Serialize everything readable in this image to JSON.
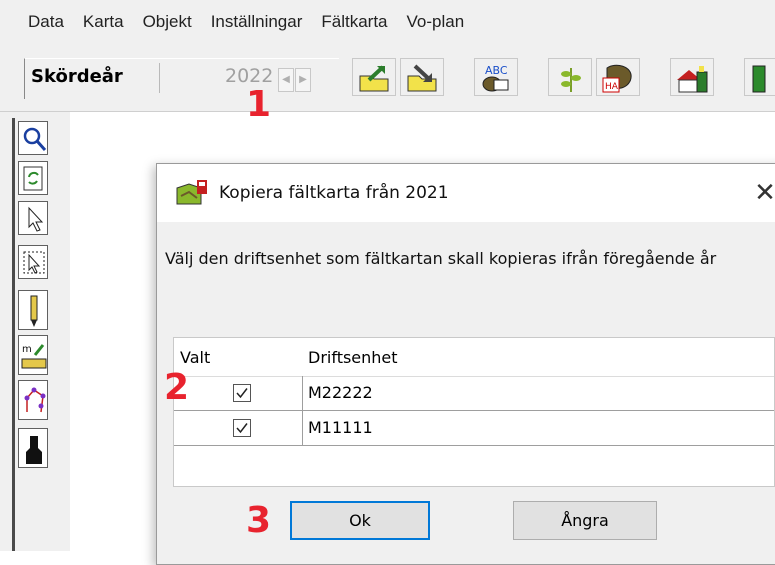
{
  "menu": {
    "items": [
      "Data",
      "Karta",
      "Objekt",
      "Inställningar",
      "Fältkarta",
      "Vo-plan"
    ]
  },
  "toolbar": {
    "year_label": "Skördeår",
    "year_value": "2022"
  },
  "annotations": {
    "step1": "1",
    "step2": "2",
    "step3": "3"
  },
  "dialog": {
    "title": "Kopiera fältkarta från 2021",
    "close": "✕",
    "instruction": "Välj den driftsenhet som fältkartan skall kopieras ifrån föregående år",
    "grid": {
      "columns": [
        "Valt",
        "Driftsenhet"
      ],
      "rows": [
        {
          "checked": true,
          "name": "M22222"
        },
        {
          "checked": true,
          "name": "M11111"
        }
      ]
    },
    "ok_label": "Ok",
    "cancel_label": "Ångra"
  },
  "colors": {
    "accent_red": "#e8232e",
    "focus_blue": "#0078d7",
    "folder_yellow": "#f2e24a"
  }
}
